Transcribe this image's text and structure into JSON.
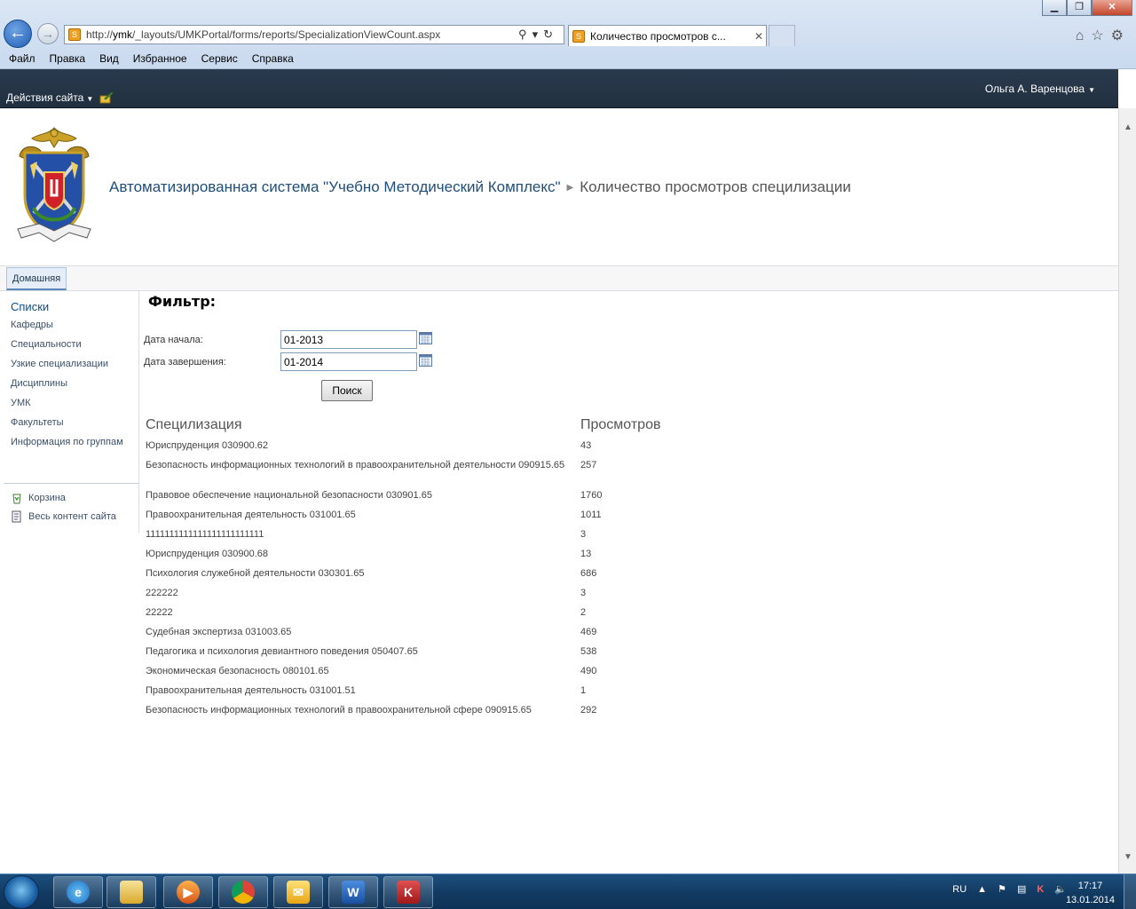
{
  "browser": {
    "window_buttons": {
      "minimize": "▁",
      "restore": "❐",
      "close": "✕"
    },
    "address": {
      "prefix": "http://",
      "host": "ymk",
      "path": "/_layouts/UMKPortal/forms/reports/SpecializationViewCount.aspx"
    },
    "tab_title": "Количество просмотров с...",
    "menu": [
      "Файл",
      "Правка",
      "Вид",
      "Избранное",
      "Сервис",
      "Справка"
    ]
  },
  "sp": {
    "site_actions": "Действия сайта",
    "user": "Ольга А. Варенцова",
    "breadcrumb_site": "Автоматизированная система \"Учебно Методический Комплекс\"",
    "breadcrumb_page": "Количество просмотров специлизации",
    "home_tab": "Домашняя"
  },
  "leftnav": {
    "heading": "Списки",
    "items": [
      "Кафедры",
      "Специальности",
      "Узкие специализации",
      "Дисциплины",
      "УМК",
      "Факультеты",
      "Информация по группам"
    ],
    "bottom": [
      {
        "label": "Корзина",
        "icon": "recycle-bin-icon"
      },
      {
        "label": "Весь контент сайта",
        "icon": "all-content-icon"
      }
    ]
  },
  "filter": {
    "title": "Фильтр:",
    "start_label": "Дата начала:",
    "start_value": "01-2013",
    "end_label": "Дата завершения:",
    "end_value": "01-2014",
    "search_label": "Поиск"
  },
  "results": {
    "col1": "Специлизация",
    "col2": "Просмотров",
    "rows": [
      {
        "name": "Юриспруденция 030900.62",
        "count": "43"
      },
      {
        "name": "Безопасность информационных технологий в правоохранительной деятельности 090915.65",
        "count": "257"
      },
      {
        "name": "Правовое обеспечение национальной безопасности 030901.65",
        "count": "1760"
      },
      {
        "name": "Правоохранительная деятельность 031001.65",
        "count": "1011"
      },
      {
        "name": "1111111111111111111111111",
        "count": "3"
      },
      {
        "name": "Юриспруденция 030900.68",
        "count": "13"
      },
      {
        "name": "Психология служебной деятельности 030301.65",
        "count": "686"
      },
      {
        "name": "222222",
        "count": "3"
      },
      {
        "name": "22222",
        "count": "2"
      },
      {
        "name": "Судебная экспертиза 031003.65",
        "count": "469"
      },
      {
        "name": "Педагогика и психология девиантного поведения 050407.65",
        "count": "538"
      },
      {
        "name": "Экономическая безопасность 080101.65",
        "count": "490"
      },
      {
        "name": "Правоохранительная деятельность 031001.51",
        "count": "1"
      },
      {
        "name": "Безопасность информационных технологий в правоохранительной сфере 090915.65",
        "count": "292"
      }
    ]
  },
  "taskbar": {
    "apps": [
      "internet-explorer",
      "file-explorer",
      "media-player",
      "chrome",
      "outlook",
      "word",
      "kaspersky"
    ],
    "lang": "RU",
    "time": "17:17",
    "date": "13.01.2014"
  },
  "colors": {
    "topbar": "#21303f",
    "link": "#1f4e79",
    "taskbar": "#123a61"
  }
}
